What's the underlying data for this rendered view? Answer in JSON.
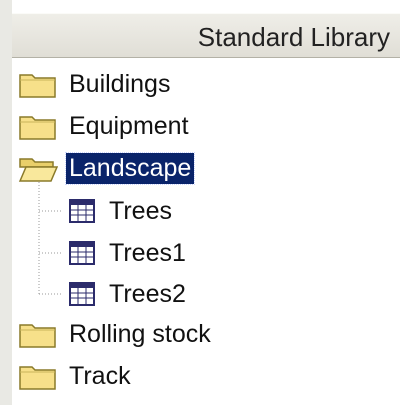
{
  "header": {
    "title": "Standard Library"
  },
  "tree": {
    "items": [
      {
        "label": "Buildings",
        "icon": "folder-closed-icon",
        "selected": false
      },
      {
        "label": "Equipment",
        "icon": "folder-closed-icon",
        "selected": false
      },
      {
        "label": "Landscape",
        "icon": "folder-open-icon",
        "selected": true,
        "children": [
          {
            "label": "Trees",
            "icon": "table-icon"
          },
          {
            "label": "Trees1",
            "icon": "table-icon"
          },
          {
            "label": "Trees2",
            "icon": "table-icon"
          }
        ]
      },
      {
        "label": "Rolling stock",
        "icon": "folder-closed-icon",
        "selected": false
      },
      {
        "label": "Track",
        "icon": "folder-closed-icon",
        "selected": false
      }
    ]
  },
  "colors": {
    "selection_bg": "#0a246a",
    "folder_fill": "#f7e08a",
    "folder_outline": "#8a7a2a"
  }
}
